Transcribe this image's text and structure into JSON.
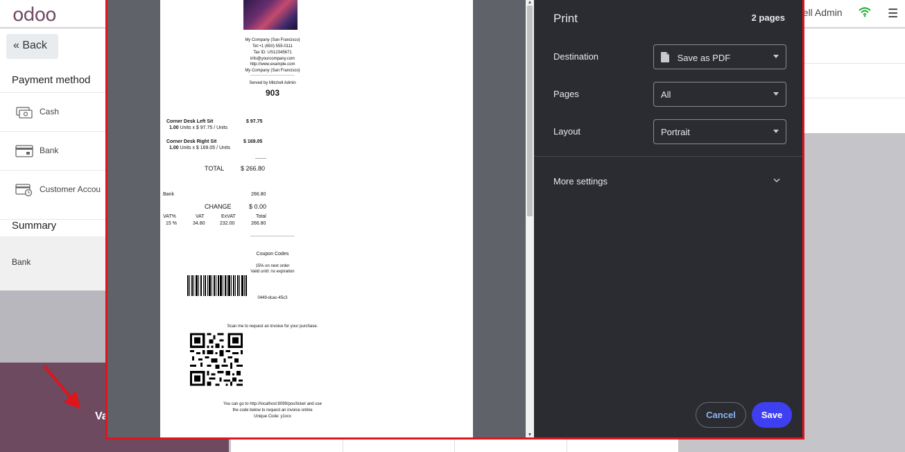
{
  "topbar": {
    "logo": "odoo",
    "user_name": "hell Admin"
  },
  "left_panel": {
    "back_label": "Back",
    "payment_method_title": "Payment method",
    "methods": [
      {
        "label": "Cash",
        "icon": "cash-icon"
      },
      {
        "label": "Bank",
        "icon": "bank-card-icon"
      },
      {
        "label": "Customer Accou",
        "icon": "customer-account-icon"
      }
    ],
    "summary_title": "Summary",
    "summary_item": "Bank"
  },
  "validate_partial": "Va",
  "print_dialog": {
    "title": "Print",
    "pages_count": "2 pages",
    "destination_label": "Destination",
    "destination_value": "Save as PDF",
    "pages_label": "Pages",
    "pages_value": "All",
    "layout_label": "Layout",
    "layout_value": "Portrait",
    "more_settings_label": "More settings",
    "cancel_label": "Cancel",
    "save_label": "Save"
  },
  "receipt": {
    "company_lines": [
      "My Company (San Francisco)",
      "Tel:+1 (650) 555-0111",
      "Tax ID: US12345671",
      "info@yourcompany.com",
      "http://www.example.com",
      "My Company (San Francisco)"
    ],
    "separator_short": "--------------------------------",
    "served_by": "Served by Mitchell Admin",
    "order_number": "903",
    "lines": [
      {
        "name": "Corner Desk Left Sit",
        "price": "$ 97.75",
        "detail_qty": "1.00",
        "detail": "Units x $ 97.75 / Units"
      },
      {
        "name": "Corner Desk Right Sit",
        "price": "$ 169.05",
        "detail_qty": "1.00",
        "detail": "Units x $ 169.05 / Units"
      }
    ],
    "total_sep": "--------",
    "total_label": "TOTAL",
    "total_value": "$ 266.80",
    "payment_name": "Bank",
    "payment_value": "266.80",
    "change_label": "CHANGE",
    "change_value": "$ 0.00",
    "tax_headers": [
      "VAT%",
      "VAT",
      "ExVAT",
      "Total"
    ],
    "tax_row": [
      "15 %",
      "34.80",
      "232.00",
      "266.80"
    ],
    "coupon_title": "Coupon Codes",
    "coupon_desc": "15% on next order",
    "coupon_valid": "Valid until: no expiration",
    "coupon_code": "0449-dcac-45c3",
    "scan_text": "Scan me to request an invoice for your purchase.",
    "footer_lines": [
      "You can go to http://localhost:8099/pos/ticket and use",
      "the code below to request an invoice online",
      "Unique Code: y1xcx"
    ]
  },
  "colors": {
    "dialog_border": "#e0141b",
    "save_button": "#3f3ff2",
    "cancel_text": "#8ab4f8",
    "settings_bg": "#2b2c31",
    "odoo_purple": "#714b67"
  }
}
